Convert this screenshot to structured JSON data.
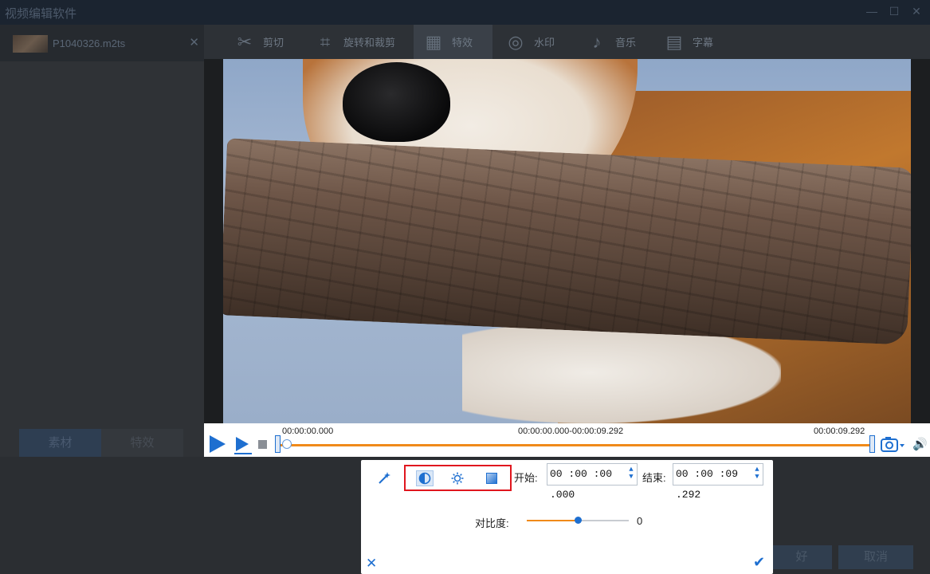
{
  "window": {
    "title": "视频编辑软件"
  },
  "file": {
    "name": "P1040326.m2ts"
  },
  "left_tabs": [
    {
      "label": "素材"
    },
    {
      "label": "特效"
    }
  ],
  "toolbar": [
    {
      "label": "剪切",
      "icon": "scissors-icon"
    },
    {
      "label": "旋转和裁剪",
      "icon": "crop-icon"
    },
    {
      "label": "特效",
      "icon": "effects-icon"
    },
    {
      "label": "水印",
      "icon": "watermark-icon"
    },
    {
      "label": "音乐",
      "icon": "music-icon"
    },
    {
      "label": "字幕",
      "icon": "subtitle-icon"
    }
  ],
  "timeline": {
    "start_label": "00:00:00.000",
    "range_label": "00:00:00.000-00:00:09.292",
    "end_label": "00:00:09.292"
  },
  "effect_panel": {
    "start_label": "开始:",
    "start_value": "00 :00 :00 .000",
    "end_label": "结束:",
    "end_value": "00 :00 :09 .292",
    "contrast_label": "对比度:",
    "contrast_value": "0",
    "contrast_level": 0.5
  },
  "buttons": {
    "ok": "好",
    "cancel": "取消"
  },
  "colors": {
    "accent": "#1e6fd0",
    "track": "#f08a1a",
    "highlight": "#e0161e"
  }
}
